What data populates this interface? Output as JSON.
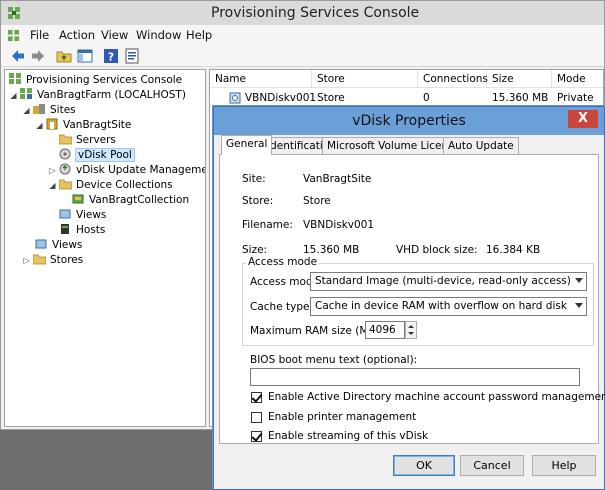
{
  "window": {
    "title": "Provisioning Services Console"
  },
  "menu": [
    "File",
    "Action",
    "View",
    "Window",
    "Help"
  ],
  "tree": {
    "root": "Provisioning Services Console",
    "farm": "VanBragtFarm (LOCALHOST)",
    "sites": "Sites",
    "site": "VanBragtSite",
    "servers": "Servers",
    "vdisk_pool": "vDisk Pool",
    "vdisk_update": "vDisk Update Manageme",
    "device_collections": "Device Collections",
    "collection": "VanBragtCollection",
    "site_views": "Views",
    "hosts": "Hosts",
    "views": "Views",
    "stores": "Stores"
  },
  "list": {
    "columns": [
      "Name",
      "Store",
      "Connections",
      "Size",
      "Mode"
    ],
    "rows": [
      {
        "name": "VBNDiskv001",
        "store": "Store",
        "connections": "0",
        "size": "15.360 MB",
        "mode": "Private"
      }
    ]
  },
  "dialog": {
    "title": "vDisk Properties",
    "close": "X",
    "tabs": [
      "General",
      "Identification",
      "Microsoft Volume Licensing",
      "Auto Update"
    ],
    "active_tab": "General",
    "site_label": "Site:",
    "site_value": "VanBragtSite",
    "store_label": "Store:",
    "store_value": "Store",
    "filename_label": "Filename:",
    "filename_value": "VBNDiskv001",
    "size_label": "Size:",
    "size_value": "15.360 MB",
    "vhd_label": "VHD block size:",
    "vhd_value": "16.384 KB",
    "access_group": "Access mode",
    "access_mode_label": "Access mode:",
    "access_mode_value": "Standard Image (multi-device, read-only access)",
    "cache_type_label": "Cache type:",
    "cache_type_value": "Cache in device RAM with overflow on hard disk",
    "max_ram_label": "Maximum RAM size (MBs):",
    "max_ram_value": "4096",
    "bios_label": "BIOS boot menu text (optional):",
    "bios_value": "",
    "checkboxes": [
      {
        "label": "Enable Active Directory machine account password management",
        "checked": true
      },
      {
        "label": "Enable printer management",
        "checked": false
      },
      {
        "label": "Enable streaming of this vDisk",
        "checked": true
      }
    ],
    "buttons": {
      "ok": "OK",
      "cancel": "Cancel",
      "help": "Help"
    }
  }
}
